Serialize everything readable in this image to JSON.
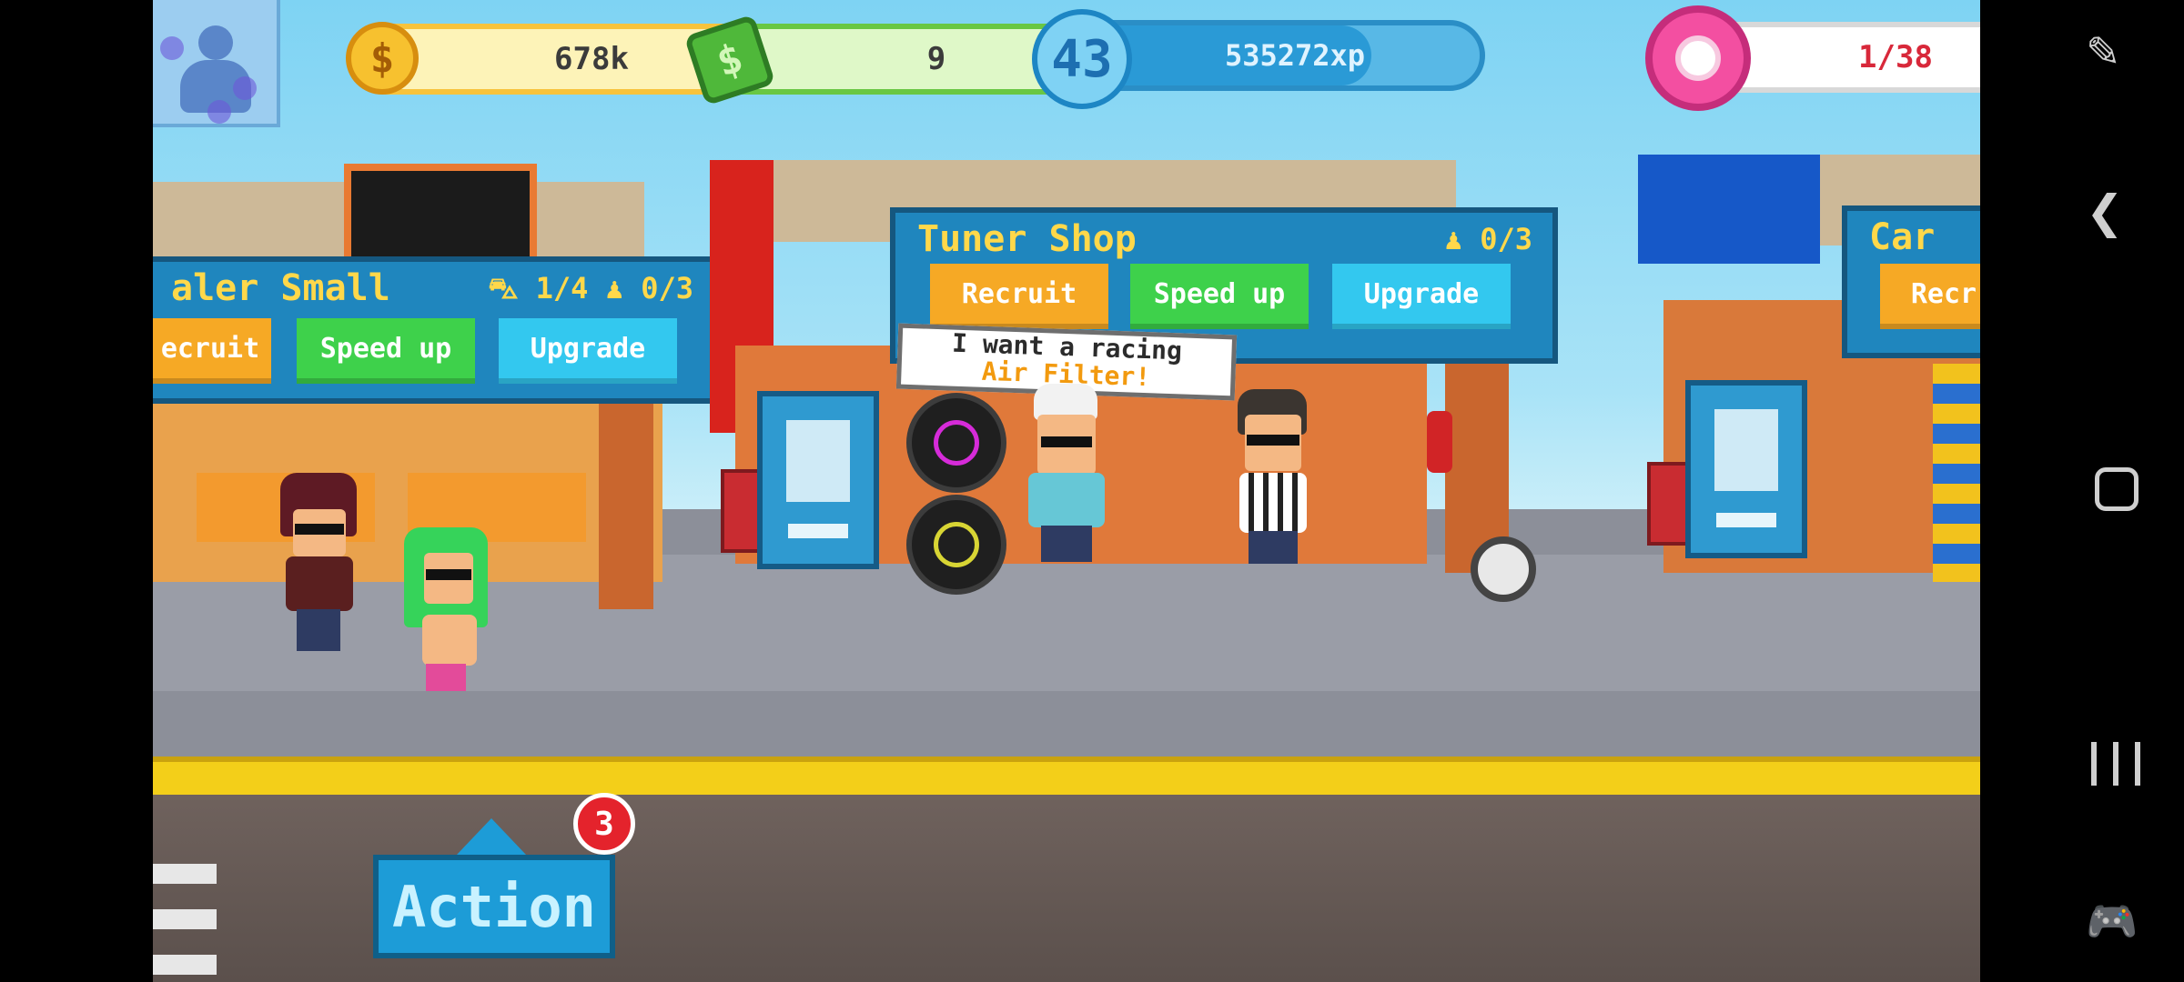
{
  "hud": {
    "coins": "678k",
    "coins_plus": "+",
    "cash": "9",
    "cash_plus": "+",
    "level": "43",
    "xp": "535272xp",
    "xp_progress": 0.75,
    "donuts": "1/38"
  },
  "shops": [
    {
      "title": "aler Small",
      "cars": "1/4",
      "staff": "0/3",
      "buttons": {
        "recruit": "ecruit",
        "speed_up": "Speed up",
        "upgrade": "Upgrade"
      }
    },
    {
      "title": "Tuner Shop",
      "staff": "0/3",
      "buttons": {
        "recruit": "Recruit",
        "speed_up": "Speed up",
        "upgrade": "Upgrade"
      }
    },
    {
      "title": "Car",
      "buttons": {
        "recruit": "Recr"
      }
    }
  ],
  "speech": {
    "line1": "I want a racing",
    "line2": "Air Filter!"
  },
  "action": {
    "label": "Action",
    "badge": "3"
  },
  "colors": {
    "sky": "#7ed3f3",
    "panel_blue": "#1f86be",
    "title_yellow": "#ffd84a",
    "btn_yellow": "#f6a925",
    "btn_green": "#3ed14b",
    "btn_cyan": "#33c8ef",
    "donut_text": "#d8283a"
  },
  "icons": {
    "coin": "dollar-coin-icon",
    "cash": "banknote-icon",
    "level": "star-level-icon",
    "donut": "donut-icon",
    "side_buttons": [
      "donut-ring-icon",
      "wrench-icon",
      "exclamation-icon"
    ],
    "nav": [
      "edit-pointer-icon",
      "back-icon",
      "home-icon",
      "recents-icon",
      "gamepad-icon"
    ]
  },
  "side_glyphs": {
    "wrench": "🔧",
    "alert": "!"
  },
  "nav": {
    "back": "❮",
    "game": "🎮",
    "edit": "✎"
  }
}
